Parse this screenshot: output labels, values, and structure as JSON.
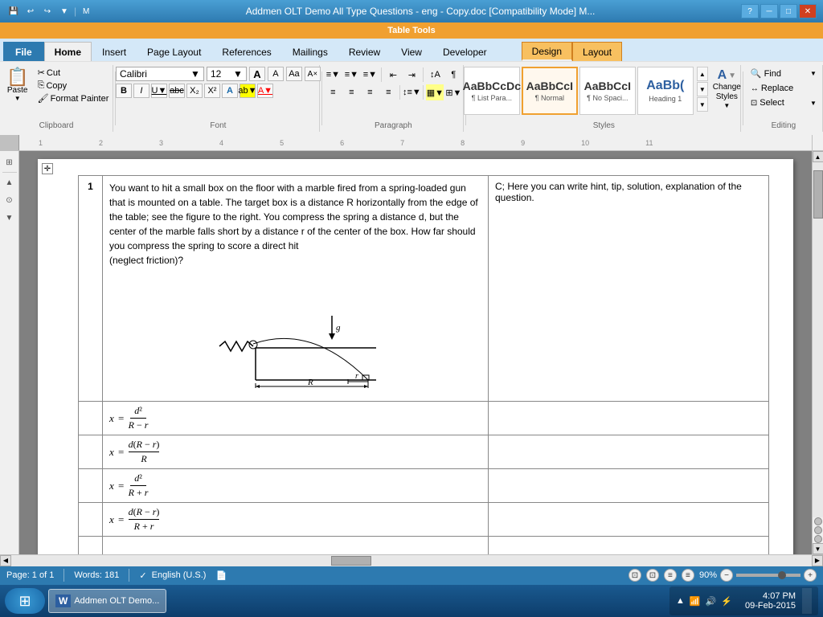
{
  "titlebar": {
    "title": "Addmen OLT Demo All Type Questions - eng - Copy.doc [Compatibility Mode] M...",
    "quick_save": "💾",
    "undo": "↩",
    "redo": "↪",
    "context_menu": "▼",
    "minimize": "─",
    "maximize": "□",
    "close": "✕"
  },
  "table_tools": {
    "label": "Table Tools"
  },
  "tabs": [
    {
      "id": "file",
      "label": "File",
      "type": "file"
    },
    {
      "id": "home",
      "label": "Home",
      "active": true
    },
    {
      "id": "insert",
      "label": "Insert"
    },
    {
      "id": "page_layout",
      "label": "Page Layout"
    },
    {
      "id": "references",
      "label": "References"
    },
    {
      "id": "mailings",
      "label": "Mailings"
    },
    {
      "id": "review",
      "label": "Review"
    },
    {
      "id": "view",
      "label": "View"
    },
    {
      "id": "developer",
      "label": "Developer"
    },
    {
      "id": "design",
      "label": "Design",
      "type": "context"
    },
    {
      "id": "layout",
      "label": "Layout",
      "type": "context"
    }
  ],
  "ribbon": {
    "clipboard": {
      "label": "Clipboard",
      "paste_label": "Paste",
      "cut_label": "Cut",
      "copy_label": "Copy",
      "format_painter_label": "Format Painter"
    },
    "font": {
      "label": "Font",
      "font_name": "Calibri",
      "font_size": "12",
      "grow_label": "A",
      "shrink_label": "A",
      "clear_label": "A",
      "bold_label": "B",
      "italic_label": "I",
      "underline_label": "U",
      "strikethrough_label": "abc",
      "subscript_label": "X₂",
      "superscript_label": "X²",
      "text_effects_label": "A",
      "highlight_label": "ab",
      "color_label": "A"
    },
    "paragraph": {
      "label": "Paragraph",
      "bullets_label": "≡",
      "numbering_label": "≡",
      "multilevel_label": "≡",
      "decrease_indent_label": "≡",
      "increase_indent_label": "≡",
      "sort_label": "↕",
      "show_hide_label": "¶",
      "align_left_label": "≡",
      "center_label": "≡",
      "align_right_label": "≡",
      "justify_label": "≡",
      "line_spacing_label": "↕",
      "shading_label": "▦",
      "borders_label": "⊞"
    },
    "styles": {
      "label": "Styles",
      "items": [
        {
          "id": "list_para",
          "preview": "¶",
          "label": "¶ List Para..."
        },
        {
          "id": "normal",
          "preview": "AaBbCcI",
          "label": "¶ Normal",
          "active": true
        },
        {
          "id": "no_spacing",
          "preview": "AaBbCcI",
          "label": "¶ No Spaci..."
        },
        {
          "id": "heading1",
          "preview": "AaBb(",
          "label": "Heading 1"
        }
      ],
      "change_styles_label": "Change\nStyles",
      "scroll_up": "▲",
      "scroll_down": "▼",
      "more": "▼"
    },
    "editing": {
      "label": "Editing",
      "find_label": "Find",
      "replace_label": "Replace",
      "select_label": "Select"
    }
  },
  "document": {
    "question_number": "1",
    "question_text": "You want to hit a small box on the floor with a marble fired from a spring-loaded gun that is mounted on a table. The target box is a distance R horizontally from the edge of the table; see the figure to the right. You compress the spring a distance d, but the center of the marble falls short by a distance r of the center of the box. How far should you compress the spring to score a direct hit",
    "question_text2": "(neglect friction)?",
    "hint_text": "C; Here you can write hint, tip, solution, explanation of the question.",
    "answers": [
      {
        "id": "a1",
        "formula_display": "x = d²/(R−r)"
      },
      {
        "id": "a2",
        "formula_display": "x = d(R−r)/R"
      },
      {
        "id": "a3",
        "formula_display": "x = d²/(R+r)"
      },
      {
        "id": "a4",
        "formula_display": "x = d(R−r)/(R+r)"
      }
    ]
  },
  "statusbar": {
    "page_info": "Page: 1 of 1",
    "words": "Words: 181",
    "language": "English (U.S.)",
    "doc_icon": "📄",
    "view_icons": [
      "⊡",
      "⊡",
      "≡",
      "≡"
    ],
    "zoom": "90%",
    "zoom_minus": "−",
    "zoom_plus": "+"
  },
  "taskbar": {
    "start_icon": "⊞",
    "word_btn": "W",
    "word_label": "Addmen OLT Demo...",
    "time": "4:07 PM",
    "date": "09-Feb-2015",
    "tray_icons": [
      "▲",
      "📶",
      "🔊",
      "⚡"
    ]
  }
}
